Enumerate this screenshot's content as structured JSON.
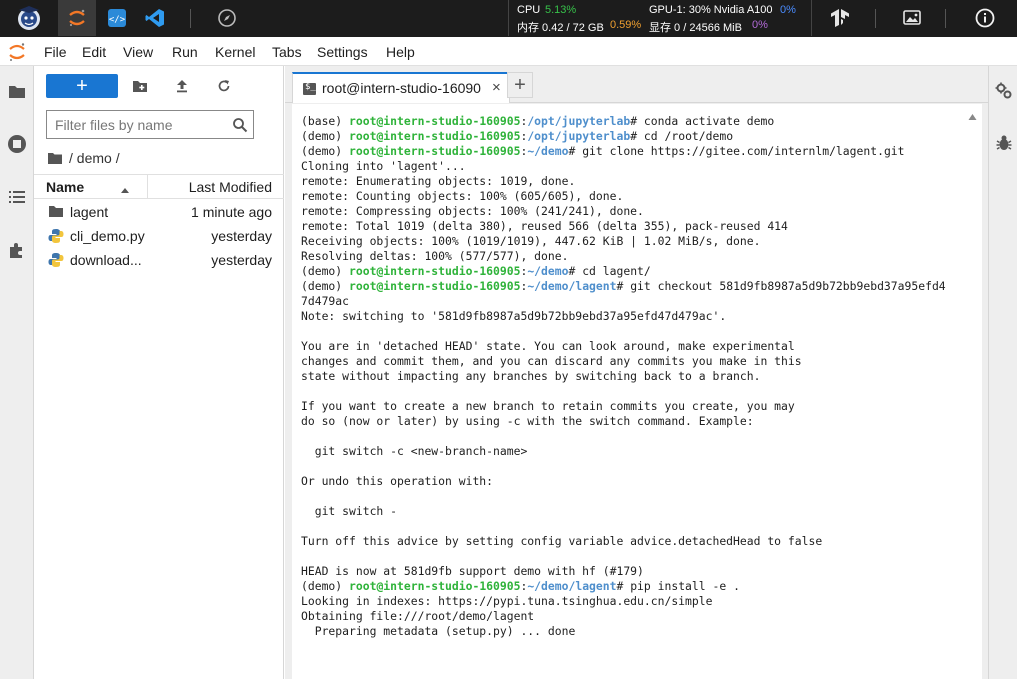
{
  "topbar": {
    "monitor": {
      "cpu_label": "CPU",
      "cpu_value": "5.13%",
      "mem_label": "内存 0.42 / 72 GB",
      "mem_value": "0.59%",
      "gpu_label": "GPU-1: 30% Nvidia A100",
      "gpu_value": "0%",
      "vram_label": "显存 0 / 24566 MiB",
      "vram_value": "0%"
    },
    "icons": [
      "intern-logo-icon",
      "jupyter-icon",
      "code-editor-icon",
      "vscode-icon",
      "compass-icon",
      "tensorflow-icon",
      "image-icon",
      "info-icon"
    ]
  },
  "menubar": {
    "items": [
      "File",
      "Edit",
      "View",
      "Run",
      "Kernel",
      "Tabs",
      "Settings",
      "Help"
    ]
  },
  "filebrowser": {
    "new_button": "+",
    "filter_placeholder": "Filter files by name",
    "breadcrumb": "/ demo /",
    "col_name": "Name",
    "col_modified": "Last Modified",
    "files": [
      {
        "name": "lagent",
        "modified": "1 minute ago",
        "type": "folder"
      },
      {
        "name": "cli_demo.py",
        "modified": "yesterday",
        "type": "python"
      },
      {
        "name": "download...",
        "modified": "yesterday",
        "type": "python"
      }
    ]
  },
  "tabs": [
    {
      "title": "root@intern-studio-16090",
      "close": "×"
    }
  ],
  "tab_add": "+",
  "terminal": {
    "lines": [
      [
        {
          "t": "(base) "
        },
        {
          "t": "root@intern-studio-160905",
          "c": "g"
        },
        {
          "t": ":"
        },
        {
          "t": "/opt/jupyterlab",
          "c": "b"
        },
        {
          "t": "# conda activate demo"
        }
      ],
      [
        {
          "t": "(demo) "
        },
        {
          "t": "root@intern-studio-160905",
          "c": "g"
        },
        {
          "t": ":"
        },
        {
          "t": "/opt/jupyterlab",
          "c": "b"
        },
        {
          "t": "# cd /root/demo"
        }
      ],
      [
        {
          "t": "(demo) "
        },
        {
          "t": "root@intern-studio-160905",
          "c": "g"
        },
        {
          "t": ":"
        },
        {
          "t": "~/demo",
          "c": "b"
        },
        {
          "t": "# git clone https://gitee.com/internlm/lagent.git"
        }
      ],
      [
        {
          "t": "Cloning into 'lagent'..."
        }
      ],
      [
        {
          "t": "remote: Enumerating objects: 1019, done."
        }
      ],
      [
        {
          "t": "remote: Counting objects: 100% (605/605), done."
        }
      ],
      [
        {
          "t": "remote: Compressing objects: 100% (241/241), done."
        }
      ],
      [
        {
          "t": "remote: Total 1019 (delta 380), reused 566 (delta 355), pack-reused 414"
        }
      ],
      [
        {
          "t": "Receiving objects: 100% (1019/1019), 447.62 KiB | 1.02 MiB/s, done."
        }
      ],
      [
        {
          "t": "Resolving deltas: 100% (577/577), done."
        }
      ],
      [
        {
          "t": "(demo) "
        },
        {
          "t": "root@intern-studio-160905",
          "c": "g"
        },
        {
          "t": ":"
        },
        {
          "t": "~/demo",
          "c": "b"
        },
        {
          "t": "# cd lagent/"
        }
      ],
      [
        {
          "t": "(demo) "
        },
        {
          "t": "root@intern-studio-160905",
          "c": "g"
        },
        {
          "t": ":"
        },
        {
          "t": "~/demo/lagent",
          "c": "b"
        },
        {
          "t": "# git checkout 581d9fb8987a5d9b72bb9ebd37a95efd4"
        }
      ],
      [
        {
          "t": "7d479ac"
        }
      ],
      [
        {
          "t": "Note: switching to '581d9fb8987a5d9b72bb9ebd37a95efd47d479ac'."
        }
      ],
      [
        {
          "t": ""
        }
      ],
      [
        {
          "t": "You are in 'detached HEAD' state. You can look around, make experimental"
        }
      ],
      [
        {
          "t": "changes and commit them, and you can discard any commits you make in this"
        }
      ],
      [
        {
          "t": "state without impacting any branches by switching back to a branch."
        }
      ],
      [
        {
          "t": ""
        }
      ],
      [
        {
          "t": "If you want to create a new branch to retain commits you create, you may"
        }
      ],
      [
        {
          "t": "do so (now or later) by using -c with the switch command. Example:"
        }
      ],
      [
        {
          "t": ""
        }
      ],
      [
        {
          "t": "  git switch -c <new-branch-name>"
        }
      ],
      [
        {
          "t": ""
        }
      ],
      [
        {
          "t": "Or undo this operation with:"
        }
      ],
      [
        {
          "t": ""
        }
      ],
      [
        {
          "t": "  git switch -"
        }
      ],
      [
        {
          "t": ""
        }
      ],
      [
        {
          "t": "Turn off this advice by setting config variable advice.detachedHead to false"
        }
      ],
      [
        {
          "t": ""
        }
      ],
      [
        {
          "t": "HEAD is now at 581d9fb support demo with hf (#179)"
        }
      ],
      [
        {
          "t": "(demo) "
        },
        {
          "t": "root@intern-studio-160905",
          "c": "g"
        },
        {
          "t": ":"
        },
        {
          "t": "~/demo/lagent",
          "c": "b"
        },
        {
          "t": "# pip install -e ."
        }
      ],
      [
        {
          "t": "Looking in indexes: https://pypi.tuna.tsinghua.edu.cn/simple"
        }
      ],
      [
        {
          "t": "Obtaining file:///root/demo/lagent"
        }
      ],
      [
        {
          "t": "  Preparing metadata (setup.py) ... done"
        }
      ]
    ]
  },
  "colors": {
    "accent": "#1976d2",
    "prompt_user": "#2fb33a",
    "prompt_path": "#4f8fcc",
    "jupyter_orange": "#f37726",
    "topbar_bg": "#1c1c1c"
  }
}
